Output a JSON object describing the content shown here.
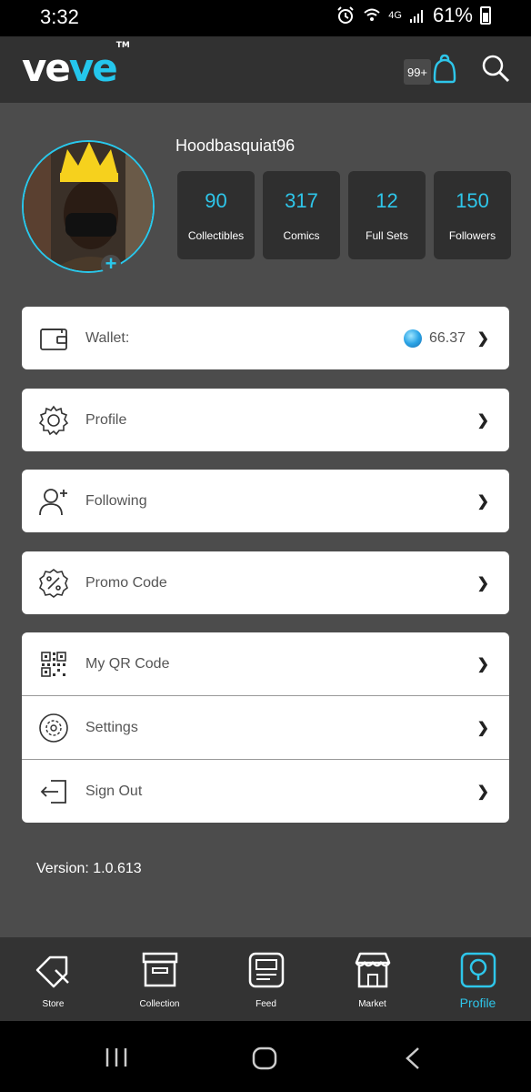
{
  "status_bar": {
    "time": "3:32",
    "network": "4G",
    "battery": "61%"
  },
  "header": {
    "logo_main": "ve",
    "logo_accent": "ve",
    "logo_tm": "TM",
    "notification_count": "99+"
  },
  "profile": {
    "username": "Hoodbasquiat96",
    "stats": [
      {
        "value": "90",
        "label": "Collectibles"
      },
      {
        "value": "317",
        "label": "Comics"
      },
      {
        "value": "12",
        "label": "Full Sets"
      },
      {
        "value": "150",
        "label": "Followers"
      }
    ]
  },
  "menu": {
    "wallet_label": "Wallet:",
    "wallet_value": "66.37",
    "profile_label": "Profile",
    "following_label": "Following",
    "promo_label": "Promo Code",
    "qr_label": "My QR Code",
    "settings_label": "Settings",
    "signout_label": "Sign Out",
    "chevron": "❯"
  },
  "version": "Version: 1.0.613",
  "bottom_nav": {
    "store": "Store",
    "collection": "Collection",
    "feed": "Feed",
    "market": "Market",
    "profile": "Profile"
  },
  "colors": {
    "accent": "#2ec6ea",
    "background": "#4c4c4c",
    "card": "#ffffff"
  }
}
